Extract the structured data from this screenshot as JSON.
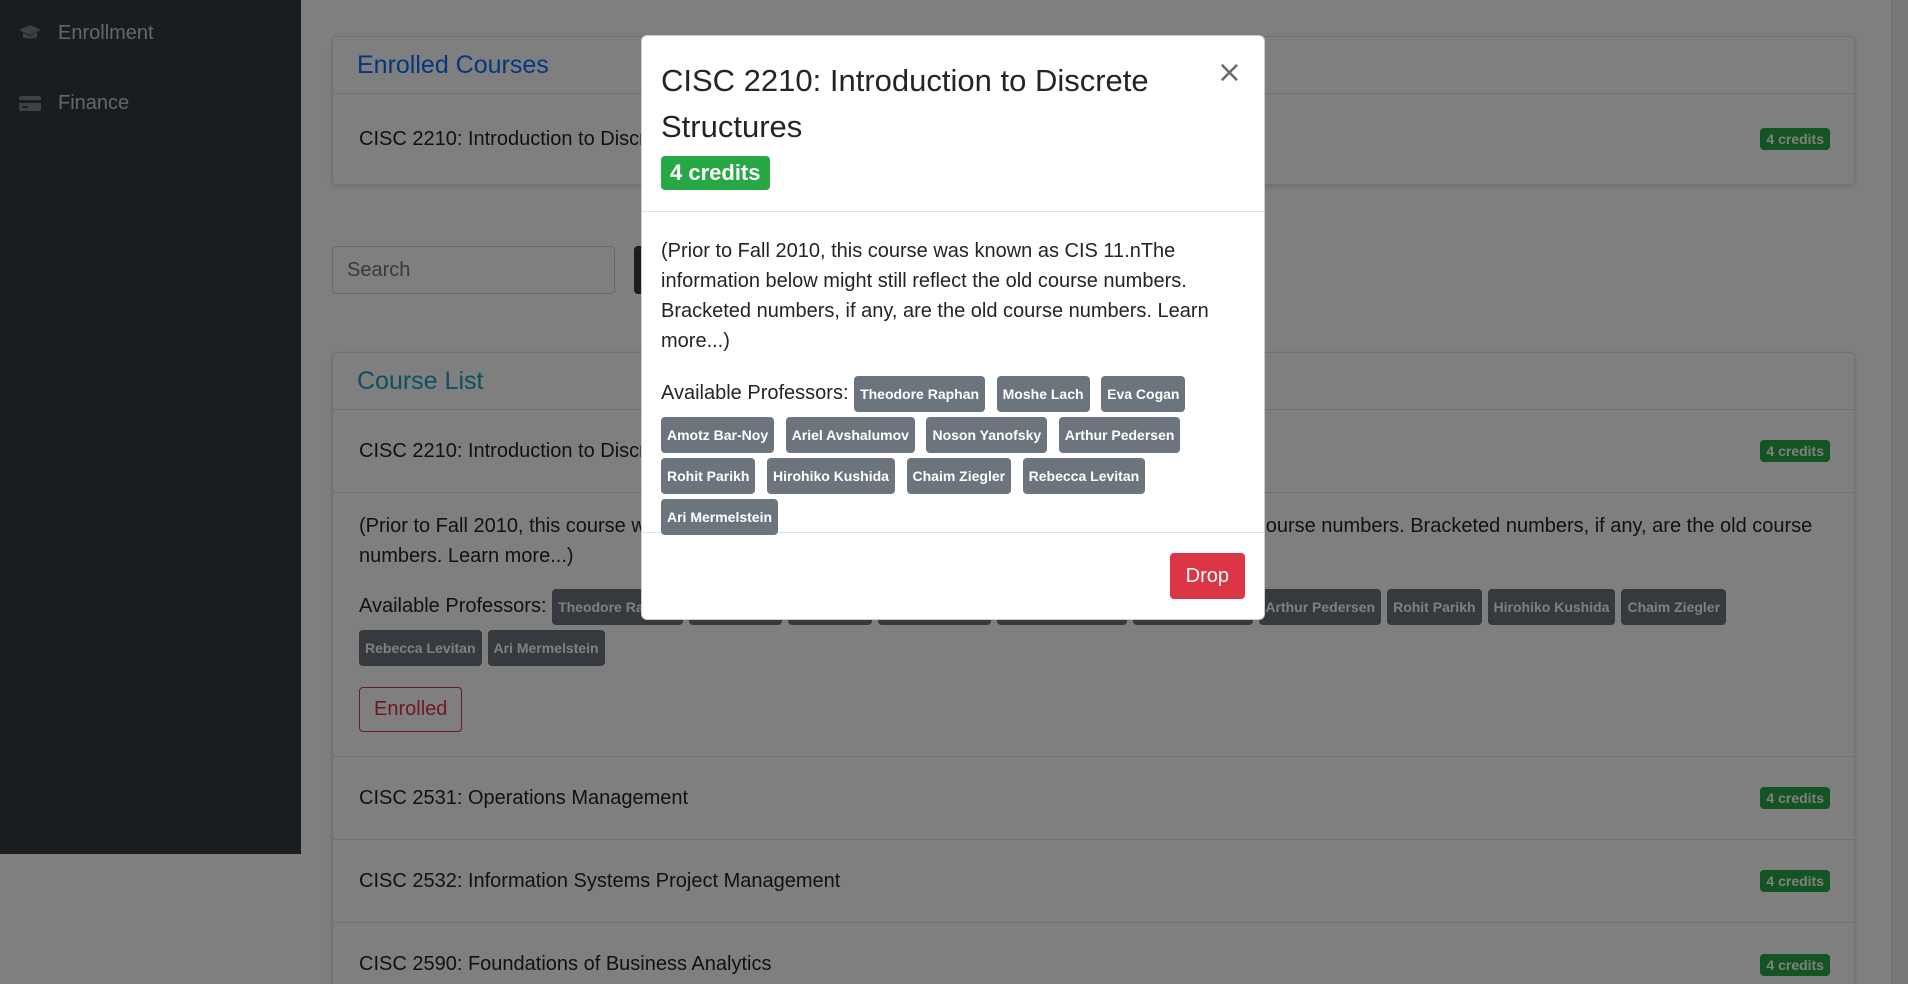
{
  "sidebar": {
    "items": [
      {
        "label": "Enrollment",
        "icon": "graduation-cap-icon"
      },
      {
        "label": "Finance",
        "icon": "credit-card-icon"
      }
    ]
  },
  "enrolled": {
    "title": "Enrolled Courses",
    "course": {
      "name": "CISC 2210: Introduction to Discrete Structures",
      "credits": "4 credits"
    }
  },
  "search": {
    "placeholder": "Search"
  },
  "course_list": {
    "title": "Course List",
    "expanded": {
      "name": "CISC 2210: Introduction to Discrete Structures",
      "credits": "4 credits",
      "description": "(Prior to Fall 2010, this course was known as CIS 11.nThe information below might still reflect the old course numbers. Bracketed numbers, if any, are the old course numbers. Learn more...)",
      "professors_label": "Available Professors:",
      "button_label": "Enrolled"
    },
    "rows": [
      {
        "name": "CISC 2531: Operations Management",
        "credits": "4 credits"
      },
      {
        "name": "CISC 2532: Information Systems Project Management",
        "credits": "4 credits"
      },
      {
        "name": "CISC 2590: Foundations of Business Analytics",
        "credits": "4 credits"
      }
    ]
  },
  "professors": [
    "Theodore Raphan",
    "Moshe Lach",
    "Eva Cogan",
    "Amotz Bar-Noy",
    "Ariel Avshalumov",
    "Noson Yanofsky",
    "Arthur Pedersen",
    "Rohit Parikh",
    "Hirohiko Kushida",
    "Chaim Ziegler",
    "Rebecca Levitan",
    "Ari Mermelstein"
  ],
  "modal": {
    "title": "CISC 2210: Introduction to Discrete Structures",
    "credits": "4 credits",
    "close_label": "×",
    "description": "(Prior to Fall 2010, this course was known as CIS 11.nThe information below might still reflect the old course numbers. Bracketed numbers, if any, are the old course numbers. Learn more...)",
    "professors_label": "Available Professors:",
    "drop_label": "Drop"
  },
  "colors": {
    "accent": "#0d6efd",
    "success": "#28a745",
    "danger": "#dc3545",
    "secondary": "#6c757d",
    "sidebar": "#343a40"
  }
}
